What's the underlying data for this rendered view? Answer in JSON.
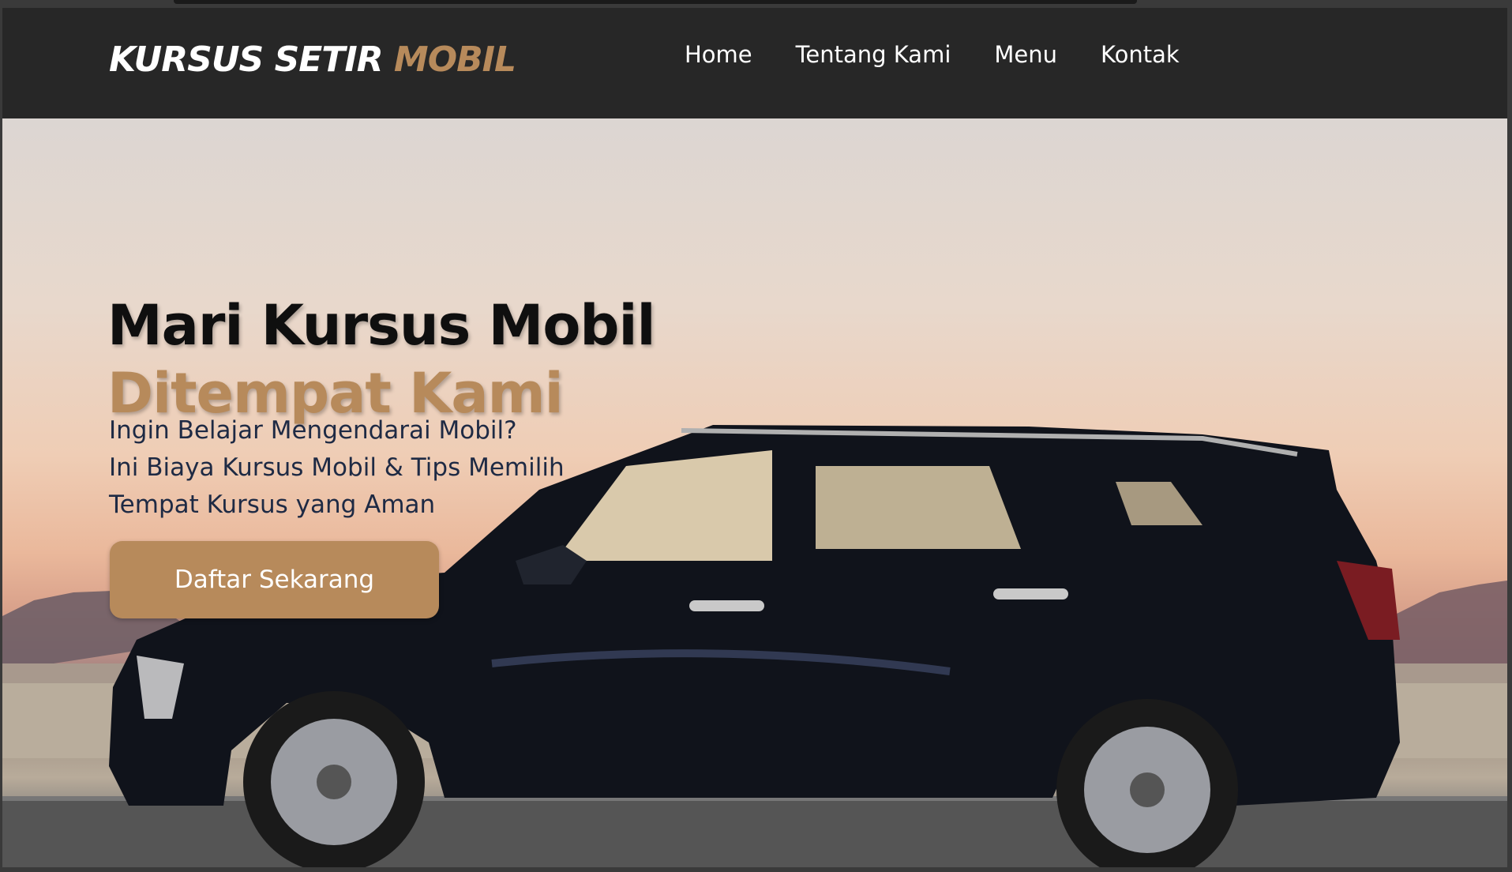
{
  "navbar": {
    "logo": {
      "part1": "KURSUS SETIR ",
      "part2": "MOBIL"
    },
    "links": [
      {
        "label": "Home"
      },
      {
        "label": "Tentang Kami"
      },
      {
        "label": "Menu"
      },
      {
        "label": "Kontak"
      }
    ]
  },
  "hero": {
    "title_line1": "Mari Kursus Mobil",
    "title_line2": "Ditempat Kami",
    "subtitle_lines": [
      "Ingin Belajar Mengendarai Mobil?",
      "Ini Biaya Kursus Mobil & Tips Memilih",
      "Tempat Kursus yang Aman"
    ],
    "cta_label": "Daftar Sekarang",
    "background_image": "black-suv-desert-sunset"
  },
  "colors": {
    "accent": "#b78a5b",
    "navbar_bg": "#272727",
    "title_dark": "#0f0f0f",
    "subtitle": "#1e2a44"
  }
}
